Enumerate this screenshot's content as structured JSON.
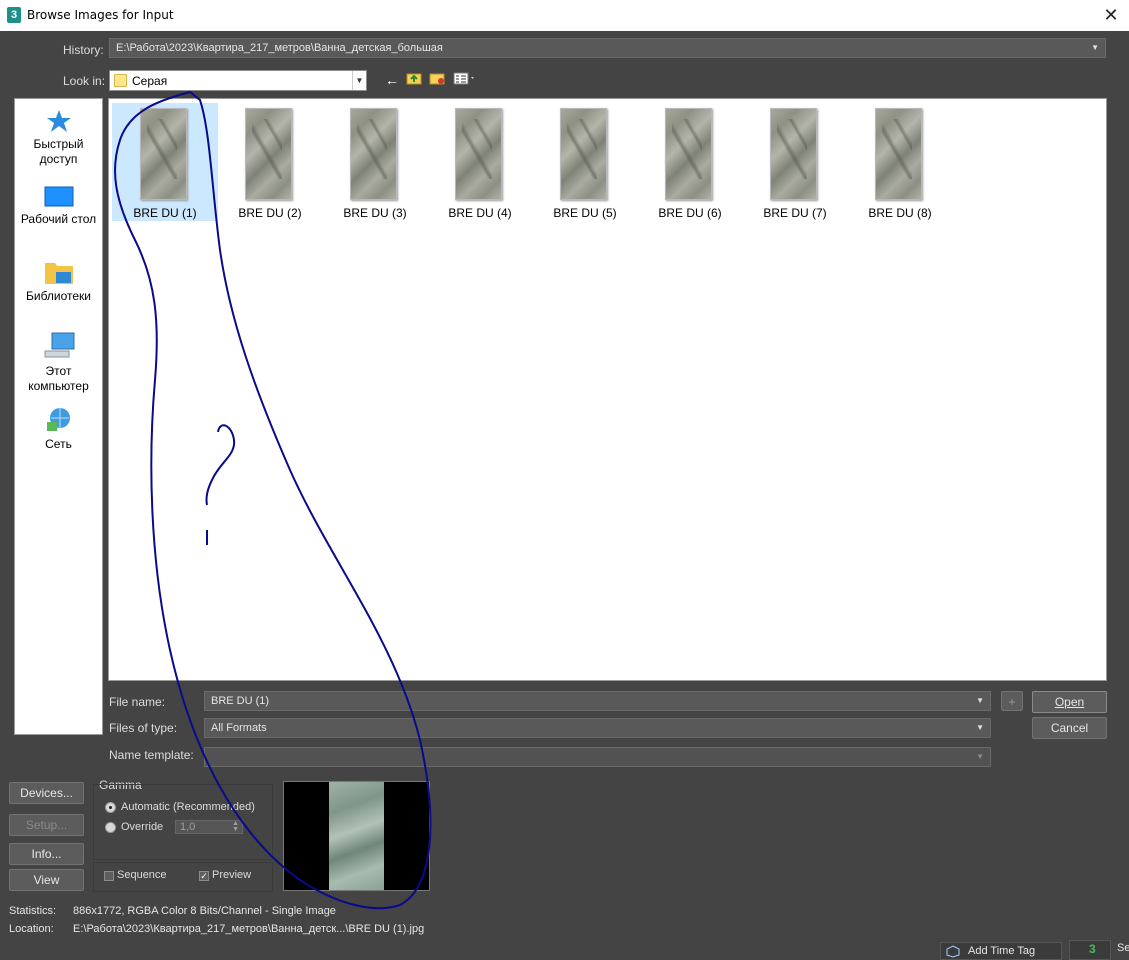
{
  "window": {
    "title": "Browse Images for Input",
    "app_icon": "3",
    "close_glyph": "✕"
  },
  "history": {
    "label": "History:",
    "value": "E:\\Работа\\2023\\Квартира_217_метров\\Ванна_детская_большая"
  },
  "lookin": {
    "label": "Look in:",
    "value": "Серая"
  },
  "places": [
    {
      "label": "Быстрый доступ",
      "icon": "star-icon"
    },
    {
      "label": "Рабочий стол",
      "icon": "desktop-icon"
    },
    {
      "label": "Библиотеки",
      "icon": "libraries-icon"
    },
    {
      "label": "Этот компьютер",
      "icon": "computer-icon"
    },
    {
      "label": "Сеть",
      "icon": "network-icon"
    }
  ],
  "files": [
    {
      "name": "BRE DU (1)",
      "selected": true
    },
    {
      "name": "BRE DU (2)"
    },
    {
      "name": "BRE DU (3)"
    },
    {
      "name": "BRE DU (4)"
    },
    {
      "name": "BRE DU (5)"
    },
    {
      "name": "BRE DU (6)"
    },
    {
      "name": "BRE DU (7)"
    },
    {
      "name": "BRE DU (8)"
    }
  ],
  "filename": {
    "label": "File name:",
    "value": "BRE DU (1)",
    "plus": "+"
  },
  "filetype": {
    "label": "Files of type:",
    "value": "All Formats"
  },
  "nametemplate": {
    "label": "Name template:",
    "value": ""
  },
  "buttons": {
    "open": "Open",
    "cancel": "Cancel",
    "devices": "Devices...",
    "setup": "Setup...",
    "info": "Info...",
    "view": "View"
  },
  "gamma": {
    "title": "Gamma",
    "automatic": "Automatic (Recommended)",
    "override": "Override",
    "override_value": "1,0"
  },
  "options": {
    "sequence": "Sequence",
    "preview": "Preview",
    "preview_checked": true
  },
  "statistics": {
    "label": "Statistics:",
    "value": "886x1772, RGBA Color 8 Bits/Channel - Single Image"
  },
  "location": {
    "label": "Location:",
    "value": "E:\\Работа\\2023\\Квартира_217_метров\\Ванна_детск...\\BRE DU (1).jpg"
  },
  "taskbar": {
    "add_time_tag": "Add Time Tag",
    "partial": "Se"
  },
  "colors": {
    "background": "#444444",
    "selection": "#cce8ff",
    "annotation": "#0a0a8c"
  }
}
